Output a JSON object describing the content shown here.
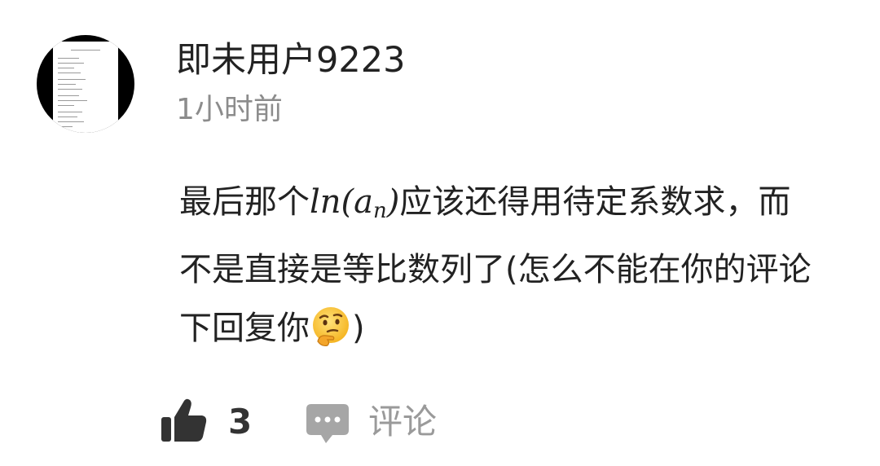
{
  "author": {
    "name": "即未用户9223",
    "avatar_icon": "document-thumbnail-avatar"
  },
  "time": "1小时前",
  "comment": {
    "text_before_math": "最后那个",
    "math_base": "ln(a",
    "math_sub": "n",
    "math_close": ")",
    "text_after_math": "应该还得用待定系数求，而不是直接是等比数列了(怎么不能在你的评论下回复你",
    "emoji": "thinking-face-emoji",
    "text_end": ")"
  },
  "actions": {
    "like_icon": "thumbs-up-icon",
    "like_count": "3",
    "comment_icon": "comment-bubble-icon",
    "comment_label": "评论"
  },
  "colors": {
    "primary_text": "#222222",
    "secondary_text": "#8c8c8c",
    "action_icon": "#333333",
    "comment_icon": "#a6a6a6"
  }
}
